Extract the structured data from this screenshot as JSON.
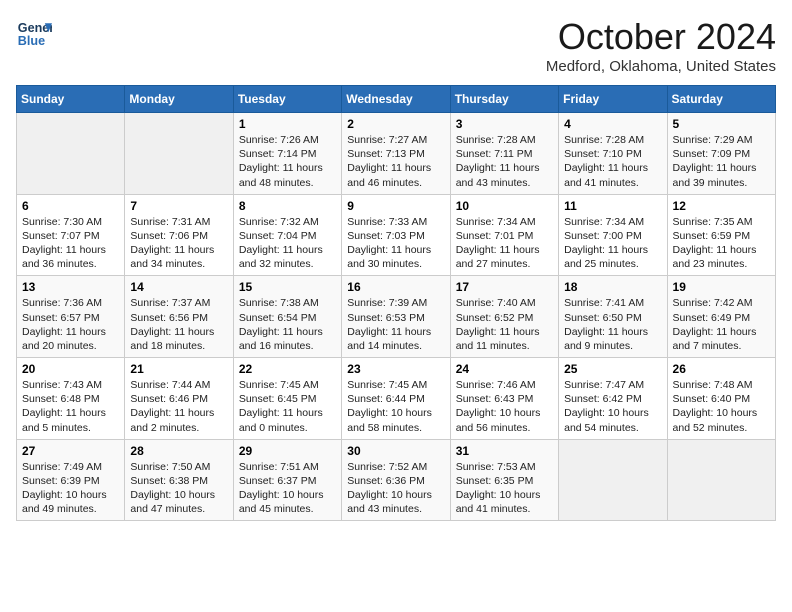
{
  "logo": {
    "line1": "General",
    "line2": "Blue"
  },
  "title": "October 2024",
  "location": "Medford, Oklahoma, United States",
  "weekdays": [
    "Sunday",
    "Monday",
    "Tuesday",
    "Wednesday",
    "Thursday",
    "Friday",
    "Saturday"
  ],
  "weeks": [
    [
      {
        "day": "",
        "info": ""
      },
      {
        "day": "",
        "info": ""
      },
      {
        "day": "1",
        "info": "Sunrise: 7:26 AM\nSunset: 7:14 PM\nDaylight: 11 hours and 48 minutes."
      },
      {
        "day": "2",
        "info": "Sunrise: 7:27 AM\nSunset: 7:13 PM\nDaylight: 11 hours and 46 minutes."
      },
      {
        "day": "3",
        "info": "Sunrise: 7:28 AM\nSunset: 7:11 PM\nDaylight: 11 hours and 43 minutes."
      },
      {
        "day": "4",
        "info": "Sunrise: 7:28 AM\nSunset: 7:10 PM\nDaylight: 11 hours and 41 minutes."
      },
      {
        "day": "5",
        "info": "Sunrise: 7:29 AM\nSunset: 7:09 PM\nDaylight: 11 hours and 39 minutes."
      }
    ],
    [
      {
        "day": "6",
        "info": "Sunrise: 7:30 AM\nSunset: 7:07 PM\nDaylight: 11 hours and 36 minutes."
      },
      {
        "day": "7",
        "info": "Sunrise: 7:31 AM\nSunset: 7:06 PM\nDaylight: 11 hours and 34 minutes."
      },
      {
        "day": "8",
        "info": "Sunrise: 7:32 AM\nSunset: 7:04 PM\nDaylight: 11 hours and 32 minutes."
      },
      {
        "day": "9",
        "info": "Sunrise: 7:33 AM\nSunset: 7:03 PM\nDaylight: 11 hours and 30 minutes."
      },
      {
        "day": "10",
        "info": "Sunrise: 7:34 AM\nSunset: 7:01 PM\nDaylight: 11 hours and 27 minutes."
      },
      {
        "day": "11",
        "info": "Sunrise: 7:34 AM\nSunset: 7:00 PM\nDaylight: 11 hours and 25 minutes."
      },
      {
        "day": "12",
        "info": "Sunrise: 7:35 AM\nSunset: 6:59 PM\nDaylight: 11 hours and 23 minutes."
      }
    ],
    [
      {
        "day": "13",
        "info": "Sunrise: 7:36 AM\nSunset: 6:57 PM\nDaylight: 11 hours and 20 minutes."
      },
      {
        "day": "14",
        "info": "Sunrise: 7:37 AM\nSunset: 6:56 PM\nDaylight: 11 hours and 18 minutes."
      },
      {
        "day": "15",
        "info": "Sunrise: 7:38 AM\nSunset: 6:54 PM\nDaylight: 11 hours and 16 minutes."
      },
      {
        "day": "16",
        "info": "Sunrise: 7:39 AM\nSunset: 6:53 PM\nDaylight: 11 hours and 14 minutes."
      },
      {
        "day": "17",
        "info": "Sunrise: 7:40 AM\nSunset: 6:52 PM\nDaylight: 11 hours and 11 minutes."
      },
      {
        "day": "18",
        "info": "Sunrise: 7:41 AM\nSunset: 6:50 PM\nDaylight: 11 hours and 9 minutes."
      },
      {
        "day": "19",
        "info": "Sunrise: 7:42 AM\nSunset: 6:49 PM\nDaylight: 11 hours and 7 minutes."
      }
    ],
    [
      {
        "day": "20",
        "info": "Sunrise: 7:43 AM\nSunset: 6:48 PM\nDaylight: 11 hours and 5 minutes."
      },
      {
        "day": "21",
        "info": "Sunrise: 7:44 AM\nSunset: 6:46 PM\nDaylight: 11 hours and 2 minutes."
      },
      {
        "day": "22",
        "info": "Sunrise: 7:45 AM\nSunset: 6:45 PM\nDaylight: 11 hours and 0 minutes."
      },
      {
        "day": "23",
        "info": "Sunrise: 7:45 AM\nSunset: 6:44 PM\nDaylight: 10 hours and 58 minutes."
      },
      {
        "day": "24",
        "info": "Sunrise: 7:46 AM\nSunset: 6:43 PM\nDaylight: 10 hours and 56 minutes."
      },
      {
        "day": "25",
        "info": "Sunrise: 7:47 AM\nSunset: 6:42 PM\nDaylight: 10 hours and 54 minutes."
      },
      {
        "day": "26",
        "info": "Sunrise: 7:48 AM\nSunset: 6:40 PM\nDaylight: 10 hours and 52 minutes."
      }
    ],
    [
      {
        "day": "27",
        "info": "Sunrise: 7:49 AM\nSunset: 6:39 PM\nDaylight: 10 hours and 49 minutes."
      },
      {
        "day": "28",
        "info": "Sunrise: 7:50 AM\nSunset: 6:38 PM\nDaylight: 10 hours and 47 minutes."
      },
      {
        "day": "29",
        "info": "Sunrise: 7:51 AM\nSunset: 6:37 PM\nDaylight: 10 hours and 45 minutes."
      },
      {
        "day": "30",
        "info": "Sunrise: 7:52 AM\nSunset: 6:36 PM\nDaylight: 10 hours and 43 minutes."
      },
      {
        "day": "31",
        "info": "Sunrise: 7:53 AM\nSunset: 6:35 PM\nDaylight: 10 hours and 41 minutes."
      },
      {
        "day": "",
        "info": ""
      },
      {
        "day": "",
        "info": ""
      }
    ]
  ]
}
